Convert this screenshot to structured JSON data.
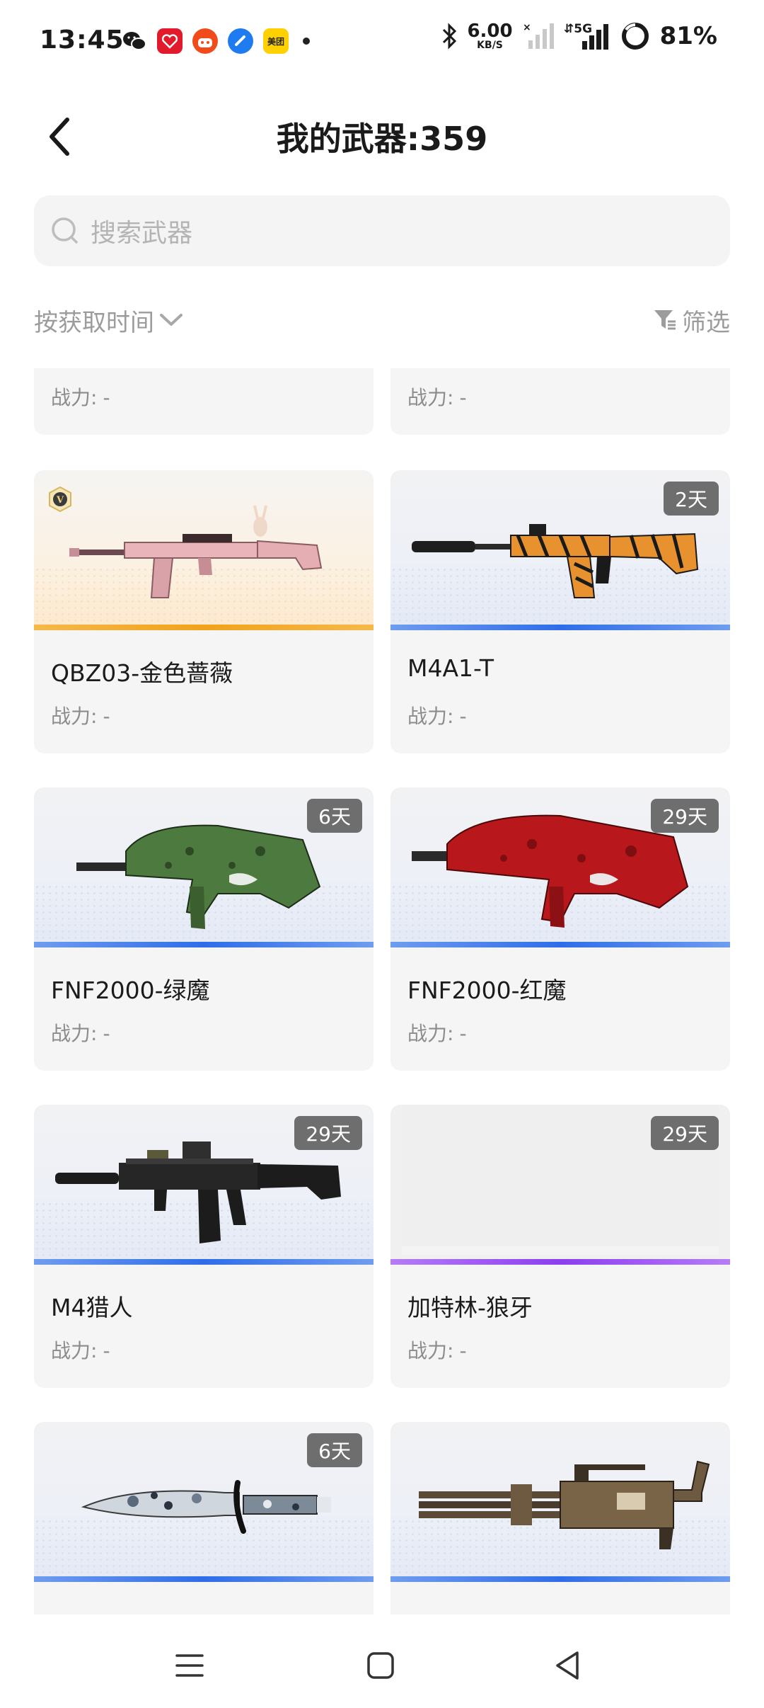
{
  "status_bar": {
    "time": "13:45",
    "net_speed_value": "6.00",
    "net_speed_unit": "KB/S",
    "network": "5G",
    "battery": "81%",
    "app_icons": [
      "wechat-icon",
      "pinduoduo-icon",
      "taobao-icon",
      "browser-icon",
      "meituan-icon"
    ],
    "meituan_label": "美团"
  },
  "header": {
    "title": "我的武器:359"
  },
  "search": {
    "placeholder": "搜索武器"
  },
  "toolbar": {
    "sort_label": "按获取时间",
    "filter_label": "筛选"
  },
  "power_label": "战力:",
  "weapons": [
    {
      "name": "",
      "power": "-",
      "badge": null,
      "rarity": "blue"
    },
    {
      "name": "",
      "power": "-",
      "badge": null,
      "rarity": "blue"
    },
    {
      "name": "QBZ03-金色蔷薇",
      "power": "-",
      "badge": null,
      "rarity": "gold",
      "vip": true
    },
    {
      "name": "M4A1-T",
      "power": "-",
      "badge": "2天",
      "rarity": "blue"
    },
    {
      "name": "FNF2000-绿魔",
      "power": "-",
      "badge": "6天",
      "rarity": "blue"
    },
    {
      "name": "FNF2000-红魔",
      "power": "-",
      "badge": "29天",
      "rarity": "blue"
    },
    {
      "name": "M4猎人",
      "power": "-",
      "badge": "29天",
      "rarity": "blue"
    },
    {
      "name": "加特林-狼牙",
      "power": "-",
      "badge": "29天",
      "rarity": "purple"
    },
    {
      "name": "",
      "power": "",
      "badge": "6天",
      "rarity": "blue"
    },
    {
      "name": "",
      "power": "",
      "badge": null,
      "rarity": "blue"
    }
  ],
  "colors": {
    "gold_rarity": "#f1a21b",
    "blue_rarity": "#2f6de8",
    "purple_rarity": "#8a3ff0",
    "badge_bg": "#6e6e6e"
  }
}
